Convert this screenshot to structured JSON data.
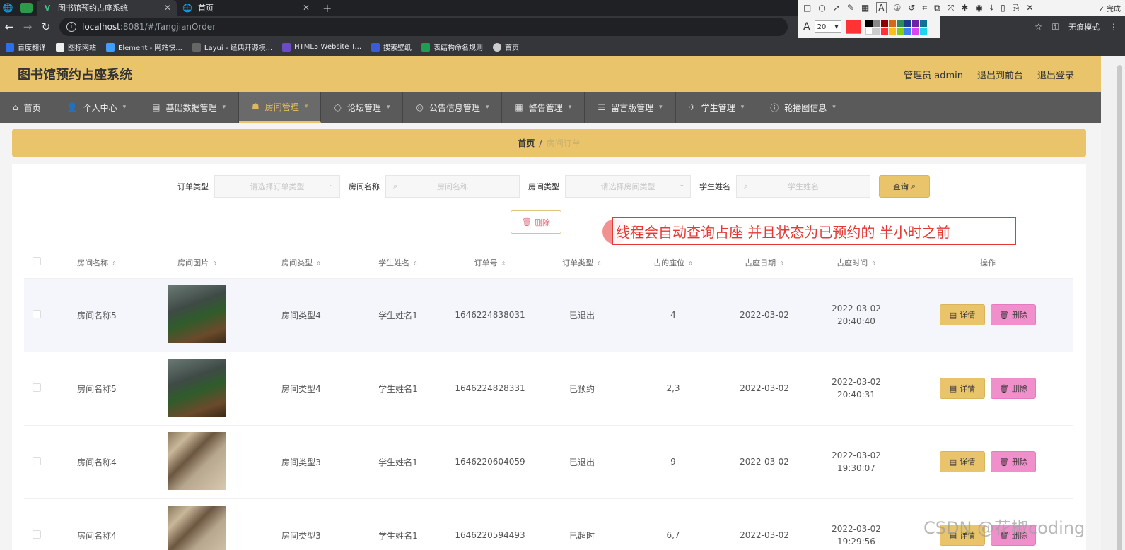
{
  "browser": {
    "tabs": [
      {
        "title": "图书馆预约占座系统",
        "active": true
      },
      {
        "title": "首页",
        "active": false
      }
    ],
    "url_host": "localhost",
    "url_path": ":8081/#/fangjianOrder",
    "incognito_label": "无痕模式",
    "bookmarks": [
      "百度翻译",
      "图标网站",
      "Element - 网站快...",
      "Layui - 经典开源模...",
      "HTML5 Website T...",
      "搜索壁纸",
      "表结构命名规则",
      "首页"
    ]
  },
  "annotation_toolbar": {
    "done_label": "完成",
    "font_size": "20",
    "current_color": "#ff3333"
  },
  "app": {
    "title": "图书馆预约占座系统",
    "user_label": "管理员 admin",
    "back_to_front": "退出到前台",
    "logout": "退出登录"
  },
  "nav": [
    {
      "label": "首页",
      "icon": "home-icon"
    },
    {
      "label": "个人中心",
      "icon": "user-icon"
    },
    {
      "label": "基础数据管理",
      "icon": "data-icon"
    },
    {
      "label": "房间管理",
      "icon": "room-icon",
      "active": true
    },
    {
      "label": "论坛管理",
      "icon": "forum-icon"
    },
    {
      "label": "公告信息管理",
      "icon": "notice-icon"
    },
    {
      "label": "警告管理",
      "icon": "warning-icon"
    },
    {
      "label": "留言版管理",
      "icon": "message-icon"
    },
    {
      "label": "学生管理",
      "icon": "student-icon"
    },
    {
      "label": "轮播图信息",
      "icon": "carousel-icon"
    }
  ],
  "breadcrumb": {
    "home": "首页",
    "separator": "/",
    "current": "房间订单"
  },
  "search": {
    "order_type_label": "订单类型",
    "order_type_placeholder": "请选择订单类型",
    "room_name_label": "房间名称",
    "room_name_placeholder": "房间名称",
    "room_type_label": "房间类型",
    "room_type_placeholder": "请选择房间类型",
    "student_label": "学生姓名",
    "student_placeholder": "学生姓名",
    "query_label": "查询"
  },
  "bulk_delete_label": "删除",
  "table": {
    "columns": [
      "房间名称",
      "房间图片",
      "房间类型",
      "学生姓名",
      "订单号",
      "订单类型",
      "占的座位",
      "占座日期",
      "占座时间",
      "操作"
    ],
    "rows": [
      {
        "room_name": "房间名称5",
        "room_type": "房间类型4",
        "student": "学生姓名1",
        "order_no": "1646224838031",
        "order_type": "已退出",
        "seats": "4",
        "date": "2022-03-02",
        "time": "2022-03-02 20:40:40",
        "image": "study-room-green"
      },
      {
        "room_name": "房间名称5",
        "room_type": "房间类型4",
        "student": "学生姓名1",
        "order_no": "1646224828331",
        "order_type": "已预约",
        "seats": "2,3",
        "date": "2022-03-02",
        "time": "2022-03-02 20:40:31",
        "image": "study-room-green"
      },
      {
        "room_name": "房间名称4",
        "room_type": "房间类型3",
        "student": "学生姓名1",
        "order_no": "1646220604059",
        "order_type": "已退出",
        "seats": "9",
        "date": "2022-03-02",
        "time": "2022-03-02 19:30:07",
        "image": "bookshelf"
      },
      {
        "room_name": "房间名称4",
        "room_type": "房间类型3",
        "student": "学生姓名1",
        "order_no": "1646220594493",
        "order_type": "已超时",
        "seats": "6,7",
        "date": "2022-03-02",
        "time": "2022-03-02 19:29:56",
        "image": "bookshelf"
      }
    ],
    "detail_label": "详情",
    "delete_label": "删除"
  },
  "annotation_text": "线程会自动查询占座 并且状态为已预约的 半小时之前",
  "watermark": "CSDN @花椒coding",
  "colors": {
    "accent": "#e9c46a",
    "nav_bg": "#5a5a5a",
    "delete_btn": "#f08fcc",
    "annotation": "#e53935"
  }
}
